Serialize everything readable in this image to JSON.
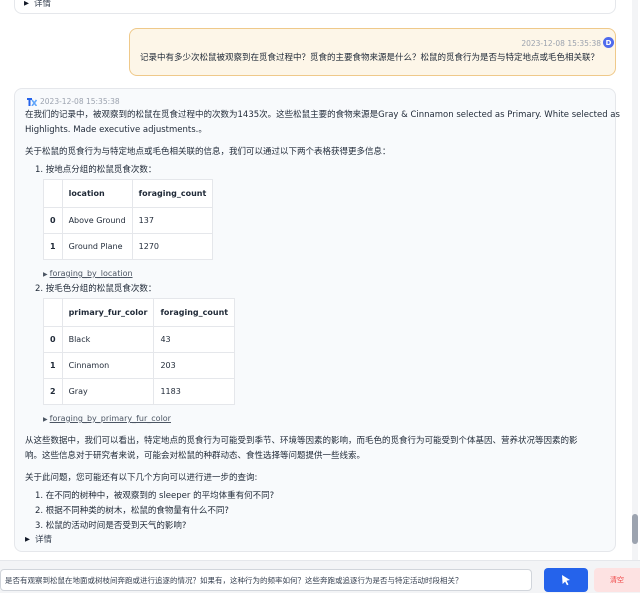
{
  "previous": {
    "details_label": "详情"
  },
  "user_message": {
    "timestamp": "2023-12-08 15:35:38",
    "avatar_letter": "D",
    "text": "记录中有多少次松鼠被观察到在觅食过程中？觅食的主要食物来源是什么？松鼠的觅食行为是否与特定地点或毛色相关联？"
  },
  "bot_message": {
    "timestamp": "2023-12-08 15:35:38",
    "para1_line1": "在我们的记录中，被观察到的松鼠在觅食过程中的次数为1435次。这些松鼠主要的食物来源是Gray & Cinnamon selected as Primary. White selected as",
    "para1_line2": "Highlights. Made executive adjustments.。",
    "para2": "关于松鼠的觅食行为与特定地点或毛色相关联的信息，我们可以通过以下两个表格获得更多信息：",
    "list1_item1": "1. 按地点分组的松鼠觅食次数：",
    "table1": {
      "headers": [
        "",
        "location",
        "foraging_count"
      ],
      "rows": [
        [
          "0",
          "Above Ground",
          "137"
        ],
        [
          "1",
          "Ground Plane",
          "1270"
        ]
      ]
    },
    "link1": "foraging_by_location",
    "list1_item2": "2. 按毛色分组的松鼠觅食次数：",
    "table2": {
      "headers": [
        "",
        "primary_fur_color",
        "foraging_count"
      ],
      "rows": [
        [
          "0",
          "Black",
          "43"
        ],
        [
          "1",
          "Cinnamon",
          "203"
        ],
        [
          "2",
          "Gray",
          "1183"
        ]
      ]
    },
    "link2": "foraging_by_primary_fur_color",
    "para3_line1": "从这些数据中，我们可以看出，特定地点的觅食行为可能受到季节、环境等因素的影响，而毛色的觅食行为可能受到个体基因、营养状况等因素的影",
    "para3_line2": "响。这些信息对于研究者来说，可能会对松鼠的种群动态、食性选择等问题提供一些线索。",
    "para4": "关于此问题，您可能还有以下几个方向可以进行进一步的查询:",
    "suggestions": [
      "1. 在不同的树种中，被观察到的 sleeper 的平均体重有何不同?",
      "2. 根据不同种类的树木，松鼠的食物量有什么不同?",
      "3. 松鼠的活动时间是否受到天气的影响?"
    ],
    "details_label": "详情"
  },
  "input": {
    "value": "是否有观察到松鼠在地面或树枝间奔跑或进行追逐的情况？如果有，这种行为的频率如何？这些奔跑或追逐行为是否与特定活动时段相关？"
  },
  "clear_label": "清空",
  "colors": {
    "accent": "#2563eb",
    "user_bubble": "#fdf6e8",
    "user_border": "#efc98a",
    "clear_bg": "#fde2e2",
    "clear_text": "#ef4444"
  }
}
